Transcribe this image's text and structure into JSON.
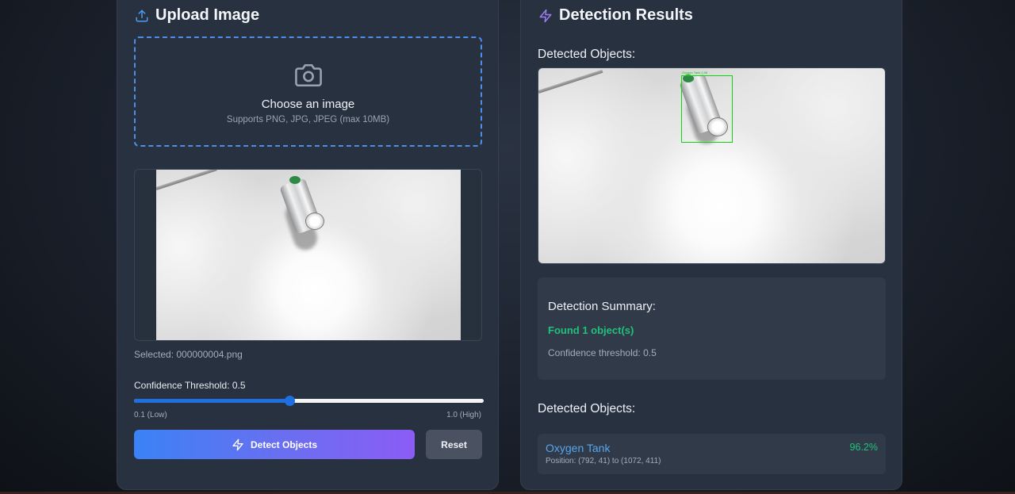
{
  "upload": {
    "title": "Upload Image",
    "drop_zone": {
      "main_text": "Choose an image",
      "hint": "Supports PNG, JPG, JPEG (max 10MB)"
    },
    "selected_file": "Selected: 000000004.png",
    "threshold": {
      "label": "Confidence Threshold: 0.5",
      "value": 0.5,
      "min": 0.1,
      "max": 1.0,
      "low_label": "0.1 (Low)",
      "high_label": "1.0 (High)"
    },
    "detect_button": "Detect Objects",
    "reset_button": "Reset"
  },
  "results": {
    "title": "Detection Results",
    "detected_heading": "Detected Objects:",
    "bbox_label": "Oxygen Tank 0.96",
    "summary": {
      "title": "Detection Summary:",
      "found": "Found 1 object(s)",
      "threshold": "Confidence threshold: 0.5"
    },
    "objects_heading": "Detected Objects:",
    "objects": [
      {
        "name": "Oxygen Tank",
        "confidence": "96.2%",
        "position": "Position: (792, 41) to (1072, 411)"
      }
    ]
  },
  "colors": {
    "accent_blue": "#3b82f6",
    "accent_purple": "#8b5cf6",
    "success_green": "#22c07a",
    "bbox_green": "#11d411"
  },
  "icons": {
    "upload": "upload-icon",
    "results": "lightning-icon",
    "camera": "camera-icon",
    "detect": "lightning-icon"
  }
}
